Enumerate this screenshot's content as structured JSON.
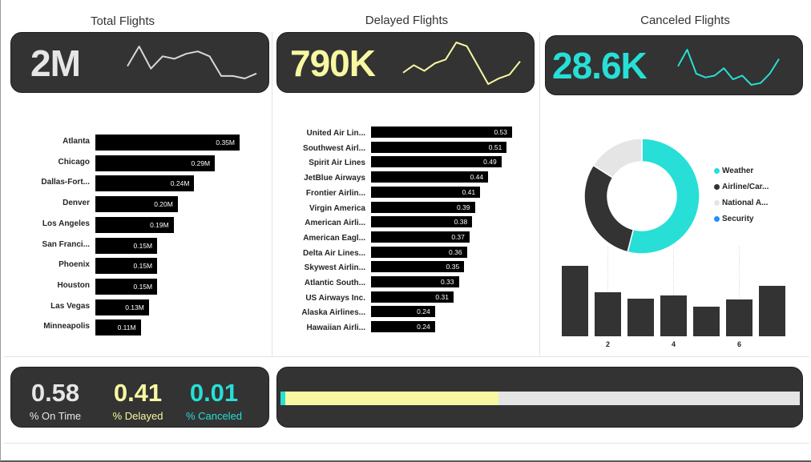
{
  "colors": {
    "white_kpi": "#e6e6e6",
    "delayed": "#f8f8a2",
    "canceled": "#27dfd6",
    "card_bg": "#333333",
    "national": "#e5e5e5",
    "security": "#1e90ff"
  },
  "kpis": {
    "total": {
      "title": "Total Flights",
      "value": "2M",
      "sparkline": [
        8,
        16,
        7,
        12,
        11,
        13,
        14,
        12,
        4,
        4,
        3,
        5
      ]
    },
    "delayed": {
      "title": "Delayed Flights",
      "value": "790K",
      "sparkline": [
        8,
        12,
        9,
        13,
        15,
        24,
        22,
        12,
        2,
        5,
        7,
        14
      ]
    },
    "canceled": {
      "title": "Canceled Flights",
      "value": "28.6K",
      "sparkline": [
        14,
        23,
        10,
        8,
        9,
        13,
        7,
        9,
        4,
        5,
        10,
        18
      ]
    }
  },
  "airports": {
    "items": [
      {
        "label": "Atlanta",
        "value": 0.35,
        "text": "0.35M"
      },
      {
        "label": "Chicago",
        "value": 0.29,
        "text": "0.29M"
      },
      {
        "label": "Dallas-Fort...",
        "value": 0.24,
        "text": "0.24M"
      },
      {
        "label": "Denver",
        "value": 0.2,
        "text": "0.20M"
      },
      {
        "label": "Los Angeles",
        "value": 0.19,
        "text": "0.19M"
      },
      {
        "label": "San Franci...",
        "value": 0.15,
        "text": "0.15M"
      },
      {
        "label": "Phoenix",
        "value": 0.15,
        "text": "0.15M"
      },
      {
        "label": "Houston",
        "value": 0.15,
        "text": "0.15M"
      },
      {
        "label": "Las Vegas",
        "value": 0.13,
        "text": "0.13M"
      },
      {
        "label": "Minneapolis",
        "value": 0.11,
        "text": "0.11M"
      }
    ]
  },
  "airlines": {
    "items": [
      {
        "label": "United Air Lin...",
        "value": 0.53,
        "text": "0.53"
      },
      {
        "label": "Southwest Airl...",
        "value": 0.51,
        "text": "0.51"
      },
      {
        "label": "Spirit Air Lines",
        "value": 0.49,
        "text": "0.49"
      },
      {
        "label": "JetBlue Airways",
        "value": 0.44,
        "text": "0.44"
      },
      {
        "label": "Frontier Airlin...",
        "value": 0.41,
        "text": "0.41"
      },
      {
        "label": "Virgin America",
        "value": 0.39,
        "text": "0.39"
      },
      {
        "label": "American Airli...",
        "value": 0.38,
        "text": "0.38"
      },
      {
        "label": "American Eagl...",
        "value": 0.37,
        "text": "0.37"
      },
      {
        "label": "Delta Air Lines...",
        "value": 0.36,
        "text": "0.36"
      },
      {
        "label": "Skywest Airlin...",
        "value": 0.35,
        "text": "0.35"
      },
      {
        "label": "Atlantic South...",
        "value": 0.33,
        "text": "0.33"
      },
      {
        "label": "US Airways Inc.",
        "value": 0.31,
        "text": "0.31"
      },
      {
        "label": "Alaska Airlines...",
        "value": 0.24,
        "text": "0.24"
      },
      {
        "label": "Hawaiian Airli...",
        "value": 0.24,
        "text": "0.24"
      }
    ]
  },
  "cancel_reasons": {
    "items": [
      {
        "label": "Weather",
        "value": 0.54,
        "color": "#27dfd6"
      },
      {
        "label": "Airline/Car...",
        "value": 0.3,
        "color": "#333333"
      },
      {
        "label": "National A...",
        "value": 0.16,
        "color": "#e5e5e5"
      },
      {
        "label": "Security",
        "value": 0.0,
        "color": "#1e90ff"
      }
    ]
  },
  "weekday_bars": {
    "x": [
      1,
      2,
      3,
      4,
      5,
      6,
      7
    ],
    "values": [
      88,
      55,
      47,
      51,
      37,
      46,
      63
    ],
    "ticks": [
      "2",
      "4",
      "6"
    ]
  },
  "stats": {
    "on_time": {
      "value": "0.58",
      "label": "% On Time"
    },
    "delayed": {
      "value": "0.41",
      "label": "% Delayed"
    },
    "canceled": {
      "value": "0.01",
      "label": "% Canceled"
    }
  },
  "composition": {
    "canceled": 0.01,
    "delayed": 0.41,
    "on_time": 0.58
  },
  "chart_data": [
    {
      "type": "bar",
      "categories": [
        "Atlanta",
        "Chicago",
        "Dallas-Fort...",
        "Denver",
        "Los Angeles",
        "San Franci...",
        "Phoenix",
        "Houston",
        "Las Vegas",
        "Minneapolis"
      ],
      "values": [
        0.35,
        0.29,
        0.24,
        0.2,
        0.19,
        0.15,
        0.15,
        0.15,
        0.13,
        0.11
      ],
      "title": "",
      "xlabel": "",
      "ylabel": ""
    },
    {
      "type": "bar",
      "categories": [
        "United Air Lin...",
        "Southwest Airl...",
        "Spirit Air Lines",
        "JetBlue Airways",
        "Frontier Airlin...",
        "Virgin America",
        "American Airli...",
        "American Eagl...",
        "Delta Air Lines...",
        "Skywest Airlin...",
        "Atlantic South...",
        "US Airways Inc.",
        "Alaska Airlines...",
        "Hawaiian Airli..."
      ],
      "values": [
        0.53,
        0.51,
        0.49,
        0.44,
        0.41,
        0.39,
        0.38,
        0.37,
        0.36,
        0.35,
        0.33,
        0.31,
        0.24,
        0.24
      ],
      "title": "",
      "xlabel": "",
      "ylabel": ""
    },
    {
      "type": "pie",
      "categories": [
        "Weather",
        "Airline/Car...",
        "National A...",
        "Security"
      ],
      "values": [
        0.54,
        0.3,
        0.16,
        0.0
      ],
      "legend": "right"
    },
    {
      "type": "bar",
      "x": [
        1,
        2,
        3,
        4,
        5,
        6,
        7
      ],
      "values": [
        88,
        55,
        47,
        51,
        37,
        46,
        63
      ],
      "xticks": [
        "2",
        "4",
        "6"
      ]
    }
  ]
}
